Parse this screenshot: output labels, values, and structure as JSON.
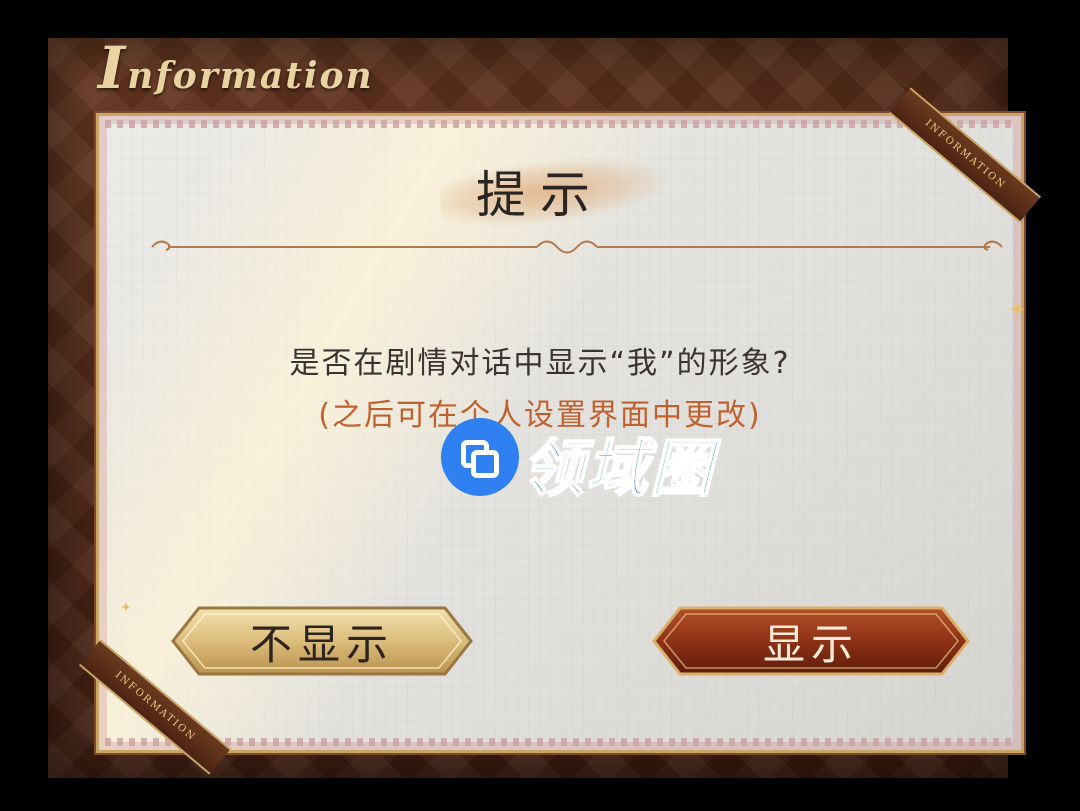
{
  "frame": {
    "title_cap": "I",
    "title_rest": "nformation",
    "ribbon_text": "INFORMATION"
  },
  "dialog": {
    "title": "提示",
    "question": "是否在剧情对话中显示“我”的形象?",
    "hint": "(之后可在个人设置界面中更改)"
  },
  "buttons": {
    "hide_label": "不显示",
    "show_label": "显示"
  },
  "watermark": {
    "text": "领域圈"
  },
  "colors": {
    "hint": "#c2602e",
    "show_button": "#8a2f14",
    "hide_button": "#d9b978",
    "watermark": "#2f80f0"
  }
}
